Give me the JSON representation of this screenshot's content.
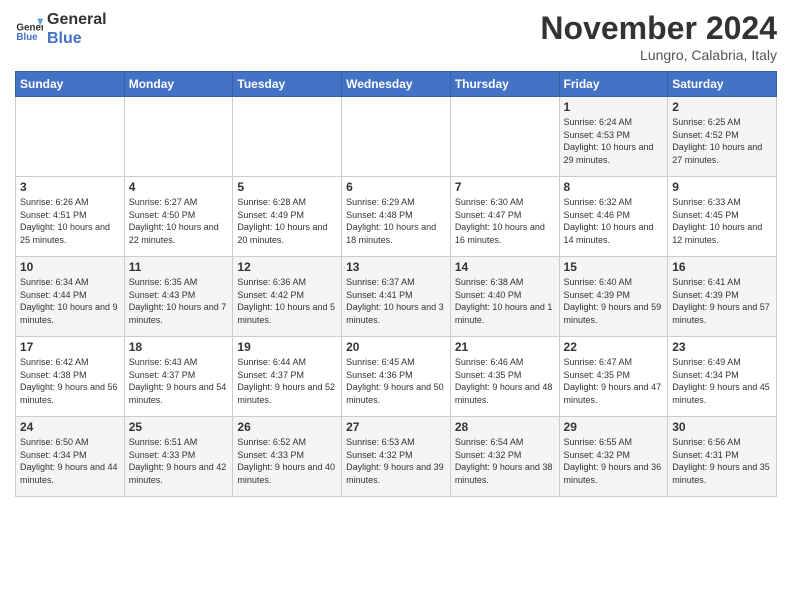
{
  "header": {
    "logo_line1": "General",
    "logo_line2": "Blue",
    "month": "November 2024",
    "location": "Lungro, Calabria, Italy"
  },
  "days_of_week": [
    "Sunday",
    "Monday",
    "Tuesday",
    "Wednesday",
    "Thursday",
    "Friday",
    "Saturday"
  ],
  "weeks": [
    [
      {
        "day": "",
        "info": ""
      },
      {
        "day": "",
        "info": ""
      },
      {
        "day": "",
        "info": ""
      },
      {
        "day": "",
        "info": ""
      },
      {
        "day": "",
        "info": ""
      },
      {
        "day": "1",
        "info": "Sunrise: 6:24 AM\nSunset: 4:53 PM\nDaylight: 10 hours and 29 minutes."
      },
      {
        "day": "2",
        "info": "Sunrise: 6:25 AM\nSunset: 4:52 PM\nDaylight: 10 hours and 27 minutes."
      }
    ],
    [
      {
        "day": "3",
        "info": "Sunrise: 6:26 AM\nSunset: 4:51 PM\nDaylight: 10 hours and 25 minutes."
      },
      {
        "day": "4",
        "info": "Sunrise: 6:27 AM\nSunset: 4:50 PM\nDaylight: 10 hours and 22 minutes."
      },
      {
        "day": "5",
        "info": "Sunrise: 6:28 AM\nSunset: 4:49 PM\nDaylight: 10 hours and 20 minutes."
      },
      {
        "day": "6",
        "info": "Sunrise: 6:29 AM\nSunset: 4:48 PM\nDaylight: 10 hours and 18 minutes."
      },
      {
        "day": "7",
        "info": "Sunrise: 6:30 AM\nSunset: 4:47 PM\nDaylight: 10 hours and 16 minutes."
      },
      {
        "day": "8",
        "info": "Sunrise: 6:32 AM\nSunset: 4:46 PM\nDaylight: 10 hours and 14 minutes."
      },
      {
        "day": "9",
        "info": "Sunrise: 6:33 AM\nSunset: 4:45 PM\nDaylight: 10 hours and 12 minutes."
      }
    ],
    [
      {
        "day": "10",
        "info": "Sunrise: 6:34 AM\nSunset: 4:44 PM\nDaylight: 10 hours and 9 minutes."
      },
      {
        "day": "11",
        "info": "Sunrise: 6:35 AM\nSunset: 4:43 PM\nDaylight: 10 hours and 7 minutes."
      },
      {
        "day": "12",
        "info": "Sunrise: 6:36 AM\nSunset: 4:42 PM\nDaylight: 10 hours and 5 minutes."
      },
      {
        "day": "13",
        "info": "Sunrise: 6:37 AM\nSunset: 4:41 PM\nDaylight: 10 hours and 3 minutes."
      },
      {
        "day": "14",
        "info": "Sunrise: 6:38 AM\nSunset: 4:40 PM\nDaylight: 10 hours and 1 minute."
      },
      {
        "day": "15",
        "info": "Sunrise: 6:40 AM\nSunset: 4:39 PM\nDaylight: 9 hours and 59 minutes."
      },
      {
        "day": "16",
        "info": "Sunrise: 6:41 AM\nSunset: 4:39 PM\nDaylight: 9 hours and 57 minutes."
      }
    ],
    [
      {
        "day": "17",
        "info": "Sunrise: 6:42 AM\nSunset: 4:38 PM\nDaylight: 9 hours and 56 minutes."
      },
      {
        "day": "18",
        "info": "Sunrise: 6:43 AM\nSunset: 4:37 PM\nDaylight: 9 hours and 54 minutes."
      },
      {
        "day": "19",
        "info": "Sunrise: 6:44 AM\nSunset: 4:37 PM\nDaylight: 9 hours and 52 minutes."
      },
      {
        "day": "20",
        "info": "Sunrise: 6:45 AM\nSunset: 4:36 PM\nDaylight: 9 hours and 50 minutes."
      },
      {
        "day": "21",
        "info": "Sunrise: 6:46 AM\nSunset: 4:35 PM\nDaylight: 9 hours and 48 minutes."
      },
      {
        "day": "22",
        "info": "Sunrise: 6:47 AM\nSunset: 4:35 PM\nDaylight: 9 hours and 47 minutes."
      },
      {
        "day": "23",
        "info": "Sunrise: 6:49 AM\nSunset: 4:34 PM\nDaylight: 9 hours and 45 minutes."
      }
    ],
    [
      {
        "day": "24",
        "info": "Sunrise: 6:50 AM\nSunset: 4:34 PM\nDaylight: 9 hours and 44 minutes."
      },
      {
        "day": "25",
        "info": "Sunrise: 6:51 AM\nSunset: 4:33 PM\nDaylight: 9 hours and 42 minutes."
      },
      {
        "day": "26",
        "info": "Sunrise: 6:52 AM\nSunset: 4:33 PM\nDaylight: 9 hours and 40 minutes."
      },
      {
        "day": "27",
        "info": "Sunrise: 6:53 AM\nSunset: 4:32 PM\nDaylight: 9 hours and 39 minutes."
      },
      {
        "day": "28",
        "info": "Sunrise: 6:54 AM\nSunset: 4:32 PM\nDaylight: 9 hours and 38 minutes."
      },
      {
        "day": "29",
        "info": "Sunrise: 6:55 AM\nSunset: 4:32 PM\nDaylight: 9 hours and 36 minutes."
      },
      {
        "day": "30",
        "info": "Sunrise: 6:56 AM\nSunset: 4:31 PM\nDaylight: 9 hours and 35 minutes."
      }
    ]
  ]
}
